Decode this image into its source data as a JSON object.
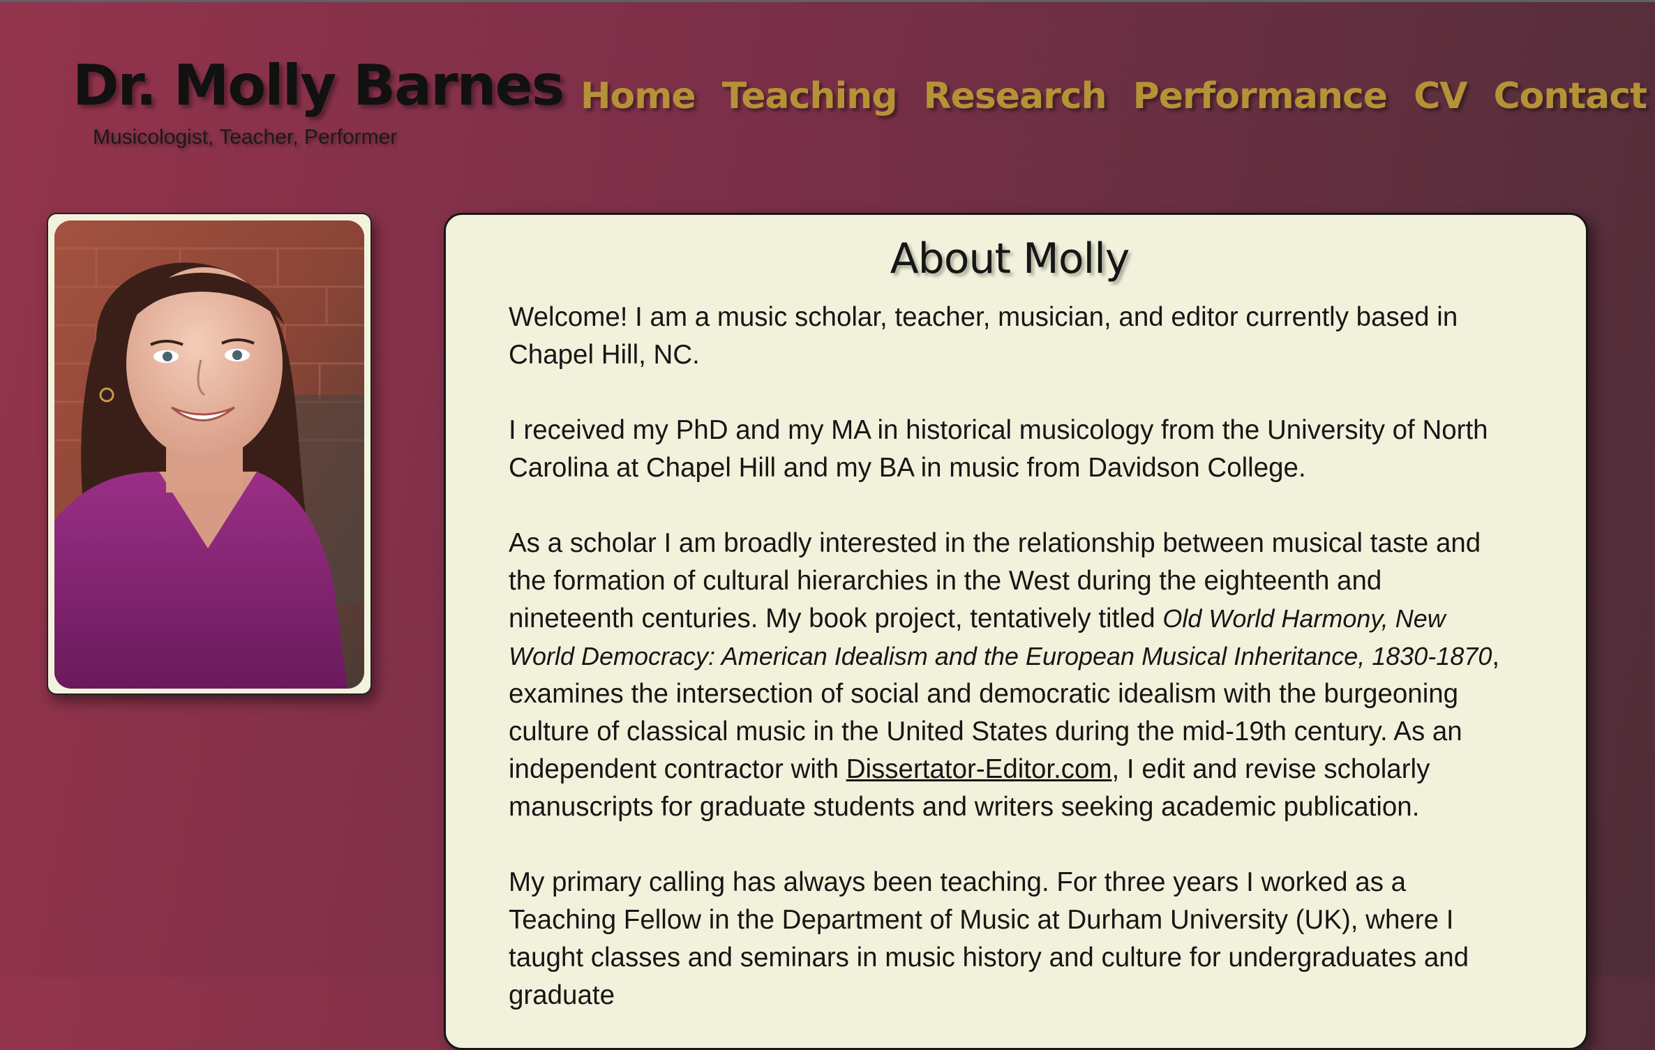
{
  "header": {
    "title": "Dr. Molly Barnes",
    "subtitle": "Musicologist, Teacher, Performer"
  },
  "nav": {
    "items": [
      {
        "label": "Home"
      },
      {
        "label": "Teaching"
      },
      {
        "label": "Research"
      },
      {
        "label": "Performance"
      },
      {
        "label": "CV"
      },
      {
        "label": "Contact"
      }
    ]
  },
  "colors": {
    "background": "#7c2f48",
    "nav_text": "#b69237",
    "card_background": "#f2f2dc",
    "heading_text": "#161616"
  },
  "photo": {
    "icon": "portrait-photo"
  },
  "main": {
    "heading": "About Molly",
    "p1": "Welcome! I am a music scholar, teacher, musician, and editor currently based in Chapel Hill, NC.",
    "p2": "I received my PhD and my MA in historical musicology from the University of North Carolina at Chapel Hill and my BA in music from Davidson College.",
    "p3_before": "As a scholar I am broadly interested in the relationship between musical taste and the formation of cultural hierarchies in the West during the eighteenth and nineteenth centuries. My book project, tentatively titled ",
    "p3_book": "Old World Harmony, New World Democracy:  American Idealism and the European Musical Inheritance, 1830-1870",
    "p3_middle": ", examines the intersection of social and democratic idealism with the burgeoning culture of classical music in the United States during the mid-19th century. As an independent contractor with ",
    "p3_link": "Dissertator-Editor.com",
    "p3_after": ", I edit and revise scholarly manuscripts for graduate students and writers seeking academic publication.",
    "p4": "My primary calling has always been teaching. For three years I worked as a Teaching Fellow in the Department of Music at Durham University (UK), where I taught classes and seminars in music history and culture for undergraduates and graduate"
  }
}
